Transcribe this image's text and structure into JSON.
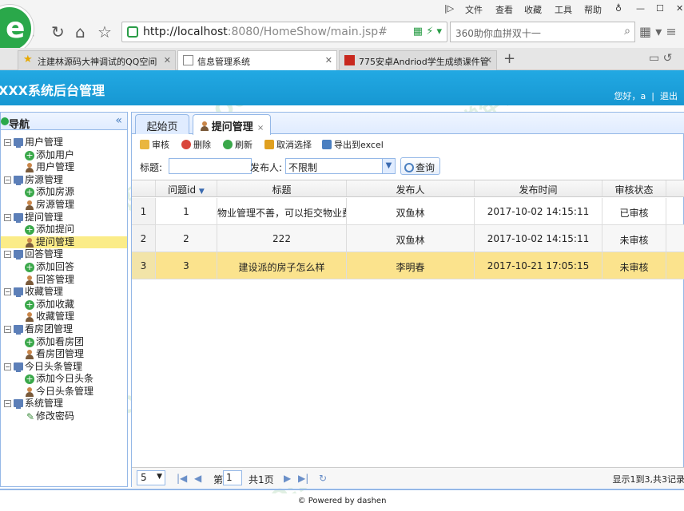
{
  "browser": {
    "menu": [
      "文件",
      "查看",
      "收藏",
      "工具",
      "帮助"
    ],
    "url_host": "http://localhost",
    "url_rest": ":8080/HomeShow/main.jsp#",
    "search_placeholder": "360助你血拼双十一",
    "tabs": [
      {
        "label": "注建林源码大神调试的QQ空间",
        "active": false
      },
      {
        "label": "信息管理系统",
        "active": true
      },
      {
        "label": "775安卓Andriod学生成绩课件管",
        "active": false
      }
    ]
  },
  "app": {
    "title": "XXX系统后台管理",
    "user_text": "您好，a",
    "logout": "退出"
  },
  "nav": {
    "title": "导航",
    "groups": [
      {
        "label": "用户管理",
        "items": [
          "添加用户",
          "用户管理"
        ]
      },
      {
        "label": "房源管理",
        "items": [
          "添加房源",
          "房源管理"
        ]
      },
      {
        "label": "提问管理",
        "items": [
          "添加提问",
          "提问管理"
        ]
      },
      {
        "label": "回答管理",
        "items": [
          "添加回答",
          "回答管理"
        ]
      },
      {
        "label": "收藏管理",
        "items": [
          "添加收藏",
          "收藏管理"
        ]
      },
      {
        "label": "看房团管理",
        "items": [
          "添加看房团",
          "看房团管理"
        ]
      },
      {
        "label": "今日头条管理",
        "items": [
          "添加今日头条",
          "今日头条管理"
        ]
      },
      {
        "label": "系统管理",
        "items": [
          "修改密码"
        ]
      }
    ],
    "selected": "提问管理"
  },
  "panel": {
    "tabs": [
      {
        "label": "起始页"
      },
      {
        "label": "提问管理"
      }
    ],
    "toolbar": [
      "审核",
      "删除",
      "刷新",
      "取消选择",
      "导出到excel"
    ],
    "filter": {
      "title_label": "标题:",
      "title_value": "",
      "publisher_label": "发布人:",
      "publisher_value": "不限制",
      "query_button": "查询"
    },
    "grid": {
      "columns": [
        "",
        "问题id",
        "标题",
        "发布人",
        "发布时间",
        "审核状态"
      ],
      "rows": [
        [
          "1",
          "1",
          "物业管理不善，可以拒交物业费",
          "双鱼林",
          "2017-10-02 14:15:11",
          "已审核"
        ],
        [
          "2",
          "2",
          "222",
          "双鱼林",
          "2017-10-02 14:15:11",
          "未审核"
        ],
        [
          "3",
          "3",
          "建设派的房子怎么样",
          "李明春",
          "2017-10-21 17:05:15",
          "未审核"
        ]
      ],
      "selected_row": 3
    },
    "pager": {
      "page_size": "5",
      "page_prefix": "第",
      "page_value": "1",
      "page_suffix": "共1页",
      "info": "显示1到3,共3记录"
    }
  },
  "footer": "© Powered by dashen",
  "watermarks": [
    "QQ:254540457",
    "常年售精品源码",
    "大神计算机设计",
    "QQ:254540457",
    "大神计算机设计",
    "QQ:254540457",
    "常年售精品源码",
    "QQ:254540457"
  ]
}
